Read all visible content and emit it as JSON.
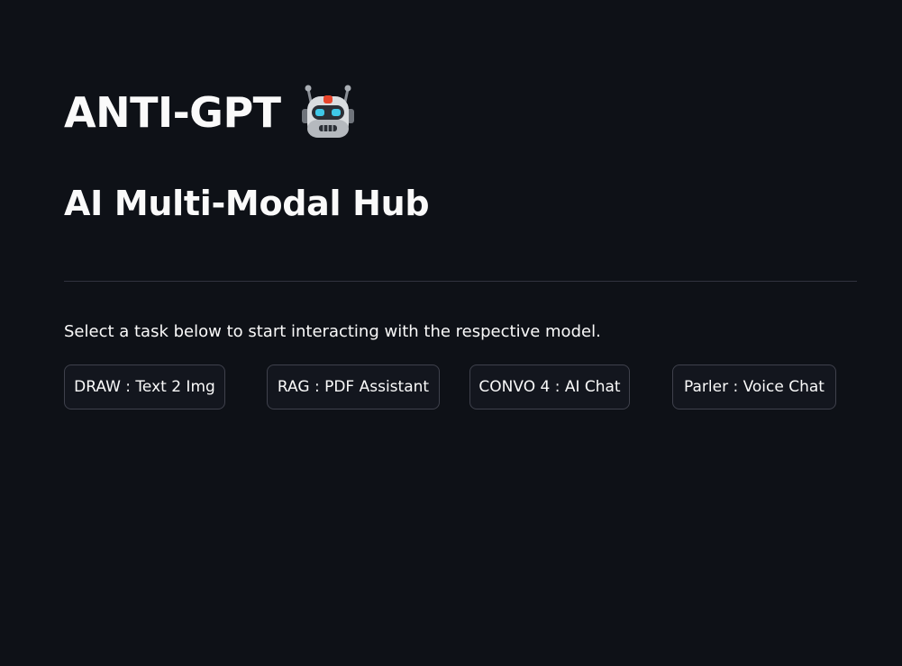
{
  "header": {
    "title": "ANTI-GPT",
    "title_icon": "robot-face-icon",
    "subtitle": "AI Multi-Modal Hub"
  },
  "main": {
    "instruction": "Select a task below to start interacting with the respective model.",
    "tasks": [
      {
        "label": "DRAW : Text 2 Img"
      },
      {
        "label": "RAG : PDF Assistant"
      },
      {
        "label": "CONVO 4 : AI Chat"
      },
      {
        "label": "Parler : Voice Chat"
      }
    ]
  },
  "colors": {
    "background": "#0e1117",
    "text": "#fafafa",
    "button_border": "#3f414c",
    "divider": "#31333f",
    "robot_accent": "#e8452c",
    "robot_eyes": "#3fc8e8"
  }
}
